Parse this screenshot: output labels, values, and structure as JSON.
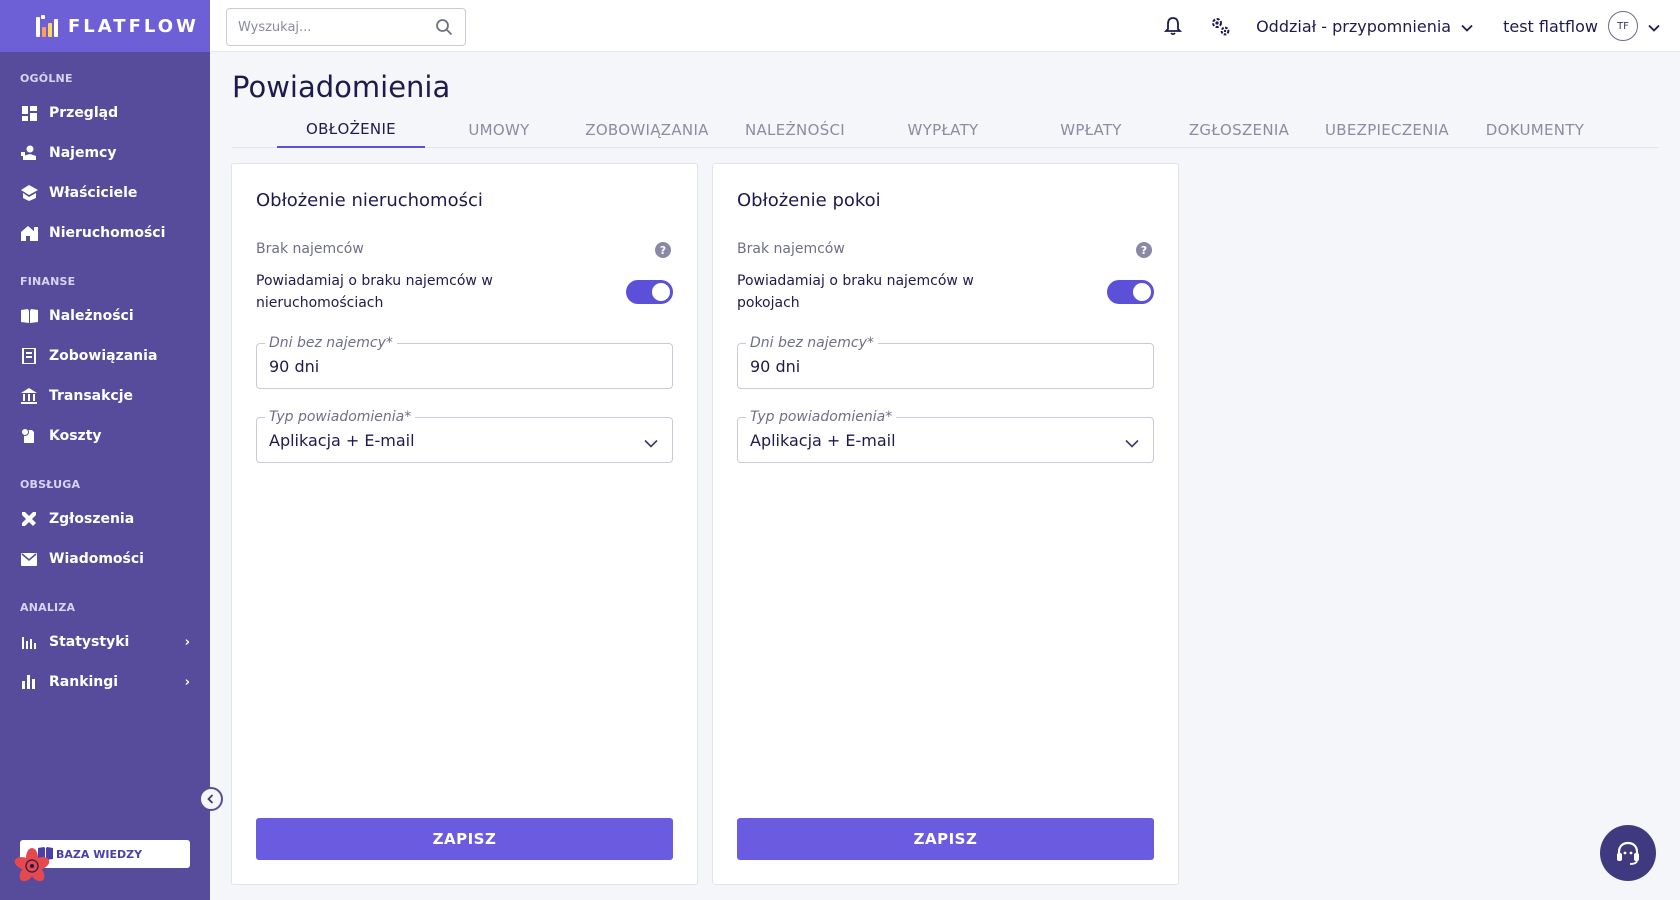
{
  "app": {
    "name": "FLATFLOW"
  },
  "search": {
    "placeholder": "Wyszukaj..."
  },
  "topbar": {
    "branch": "Oddział - przypomnienia",
    "user": "test flatflow",
    "avatar_initials": "TF"
  },
  "sidebar": {
    "sections": [
      {
        "title": "OGÓLNE",
        "items": [
          {
            "label": "Przegląd",
            "icon": "dashboard-icon"
          },
          {
            "label": "Najemcy",
            "icon": "tenant-icon"
          },
          {
            "label": "Właściciele",
            "icon": "owners-icon"
          },
          {
            "label": "Nieruchomości",
            "icon": "property-icon"
          }
        ]
      },
      {
        "title": "FINANSE",
        "items": [
          {
            "label": "Należności",
            "icon": "receivables-icon"
          },
          {
            "label": "Zobowiązania",
            "icon": "liabilities-icon"
          },
          {
            "label": "Transakcje",
            "icon": "bank-icon"
          },
          {
            "label": "Koszty",
            "icon": "costs-icon"
          }
        ]
      },
      {
        "title": "OBSŁUGA",
        "items": [
          {
            "label": "Zgłoszenia",
            "icon": "tools-icon"
          },
          {
            "label": "Wiadomości",
            "icon": "mail-icon"
          }
        ]
      },
      {
        "title": "ANALIZA",
        "items": [
          {
            "label": "Statystyki",
            "icon": "stats-icon"
          },
          {
            "label": "Rankingi",
            "icon": "ranking-icon"
          }
        ]
      }
    ],
    "knowledge_base": "BAZA WIEDZY"
  },
  "page": {
    "title": "Powiadomienia",
    "tabs": [
      {
        "label": "OBŁOŻENIE",
        "active": true
      },
      {
        "label": "UMOWY"
      },
      {
        "label": "ZOBOWIĄZANIA"
      },
      {
        "label": "NALEŻNOŚCI"
      },
      {
        "label": "WYPŁATY"
      },
      {
        "label": "WPŁATY"
      },
      {
        "label": "ZGŁOSZENIA"
      },
      {
        "label": "UBEZPIECZENIA"
      },
      {
        "label": "DOKUMENTY"
      }
    ]
  },
  "cards": [
    {
      "title": "Obłożenie nieruchomości",
      "section_label": "Brak najemców",
      "toggle_label": "Powiadamiaj o braku najemców w nieruchomościach",
      "toggle_on": true,
      "days_label": "Dni bez najemcy*",
      "days_value": "90 dni",
      "type_label": "Typ powiadomienia*",
      "type_value": "Aplikacja + E-mail",
      "save": "ZAPISZ"
    },
    {
      "title": "Obłożenie pokoi",
      "section_label": "Brak najemców",
      "toggle_label": "Powiadamiaj o braku najemców w pokojach",
      "toggle_on": true,
      "days_label": "Dni bez najemcy*",
      "days_value": "90 dni",
      "type_label": "Typ powiadomienia*",
      "type_value": "Aplikacja + E-mail",
      "save": "ZAPISZ"
    }
  ],
  "colors": {
    "sidebar": "#574c9c",
    "accent": "#6a5be0",
    "text": "#1f1a4d"
  }
}
